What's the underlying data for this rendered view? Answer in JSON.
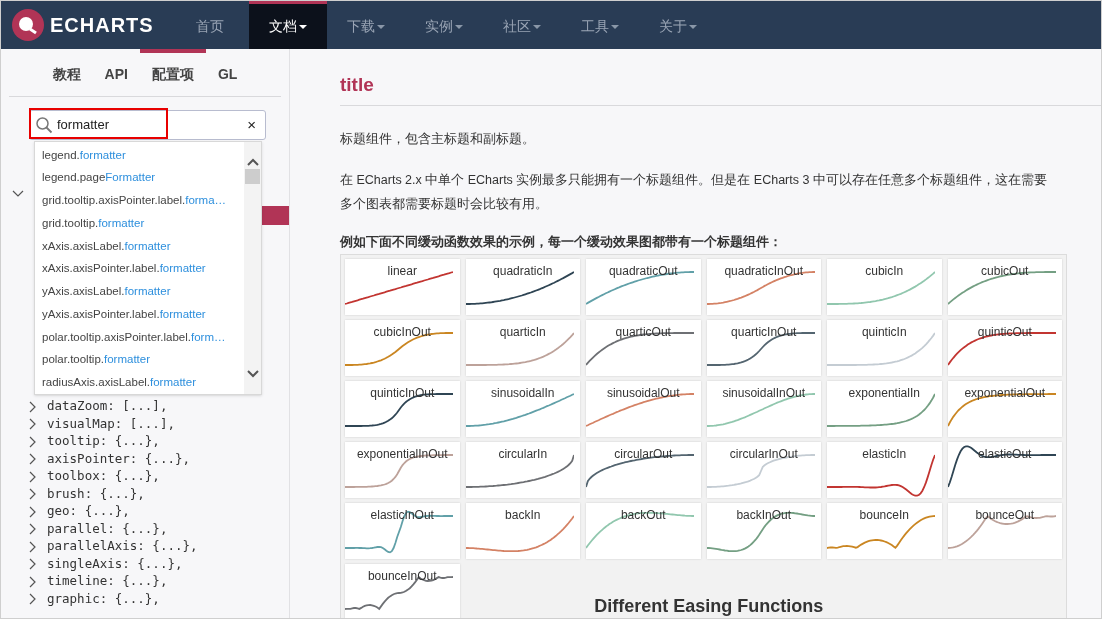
{
  "navbar": {
    "logo_text": "ECHARTS",
    "items": [
      {
        "label": "首页",
        "selected": false,
        "has_menu": false
      },
      {
        "label": "文档",
        "selected": true,
        "has_menu": true
      },
      {
        "label": "下载",
        "selected": false,
        "has_menu": true
      },
      {
        "label": "实例",
        "selected": false,
        "has_menu": true
      },
      {
        "label": "社区",
        "selected": false,
        "has_menu": true
      },
      {
        "label": "工具",
        "selected": false,
        "has_menu": true
      },
      {
        "label": "关于",
        "selected": false,
        "has_menu": true
      }
    ]
  },
  "sidebar": {
    "tabs": [
      {
        "label": "教程",
        "selected": false
      },
      {
        "label": "API",
        "selected": false
      },
      {
        "label": "配置项",
        "selected": true
      },
      {
        "label": "GL",
        "selected": false
      }
    ],
    "search": {
      "value": "formatter",
      "clear_label": "×"
    },
    "suggestions": [
      {
        "prefix": "legend.",
        "match": "formatter"
      },
      {
        "prefix": "legend.page",
        "match": "Formatter"
      },
      {
        "prefix": "grid.tooltip.axisPointer.label.",
        "match": "forma…"
      },
      {
        "prefix": "grid.tooltip.",
        "match": "formatter"
      },
      {
        "prefix": "xAxis.axisLabel.",
        "match": "formatter"
      },
      {
        "prefix": "xAxis.axisPointer.label.",
        "match": "formatter"
      },
      {
        "prefix": "yAxis.axisLabel.",
        "match": "formatter"
      },
      {
        "prefix": "yAxis.axisPointer.label.",
        "match": "formatter"
      },
      {
        "prefix": "polar.tooltip.axisPointer.label.",
        "match": "form…"
      },
      {
        "prefix": "polar.tooltip.",
        "match": "formatter"
      },
      {
        "prefix": "radiusAxis.axisLabel.",
        "match": "formatter"
      }
    ],
    "tree": {
      "expanded": true,
      "children": [
        {
          "label": "dataZoom: [...],",
          "expanded": false
        },
        {
          "label": "visualMap: [...],",
          "expanded": false
        },
        {
          "label": "tooltip: {...},",
          "expanded": false
        },
        {
          "label": "axisPointer: {...},",
          "expanded": false
        },
        {
          "label": "toolbox: {...},",
          "expanded": false
        },
        {
          "label": "brush: {...},",
          "expanded": false
        },
        {
          "label": "geo: {...},",
          "expanded": false
        },
        {
          "label": "parallel: {...},",
          "expanded": false
        },
        {
          "label": "parallelAxis: {...},",
          "expanded": false
        },
        {
          "label": "singleAxis: {...},",
          "expanded": false
        },
        {
          "label": "timeline: {...},",
          "expanded": false
        },
        {
          "label": "graphic: {...},",
          "expanded": false
        }
      ]
    }
  },
  "content": {
    "title": "title",
    "paragraphs": [
      {
        "lines": [
          "标题组件，包含主标题和副标题。"
        ]
      },
      {
        "lines": [
          "在 ECharts 2.x 中单个 ECharts 实例最多只能拥有一个标题组件。但是在 ECharts 3 中可以存在任意多个标题组件，这在需要",
          "多个图表都需要标题时会比较有用。"
        ]
      }
    ],
    "caption": "例如下面不同缓动函数效果的示例，每一个缓动效果图都带有一个标题组件：",
    "figure": {
      "title": "Different Easing Functions",
      "easings": [
        {
          "name": "linear",
          "color": "#c23531"
        },
        {
          "name": "quadraticIn",
          "color": "#2f4554"
        },
        {
          "name": "quadraticOut",
          "color": "#61a0a8"
        },
        {
          "name": "quadraticInOut",
          "color": "#d48265"
        },
        {
          "name": "cubicIn",
          "color": "#91c7ae"
        },
        {
          "name": "cubicOut",
          "color": "#749f83"
        },
        {
          "name": "cubicInOut",
          "color": "#ca8622"
        },
        {
          "name": "quarticIn",
          "color": "#bda29a"
        },
        {
          "name": "quarticOut",
          "color": "#6e7074"
        },
        {
          "name": "quarticInOut",
          "color": "#546570"
        },
        {
          "name": "quinticIn",
          "color": "#c4ccd3"
        },
        {
          "name": "quinticOut",
          "color": "#c23531"
        },
        {
          "name": "quinticInOut",
          "color": "#2f4554"
        },
        {
          "name": "sinusoidalIn",
          "color": "#61a0a8"
        },
        {
          "name": "sinusoidalOut",
          "color": "#d48265"
        },
        {
          "name": "sinusoidalInOut",
          "color": "#91c7ae"
        },
        {
          "name": "exponentialIn",
          "color": "#749f83"
        },
        {
          "name": "exponentialOut",
          "color": "#ca8622"
        },
        {
          "name": "exponentialInOut",
          "color": "#bda29a"
        },
        {
          "name": "circularIn",
          "color": "#6e7074"
        },
        {
          "name": "circularOut",
          "color": "#546570"
        },
        {
          "name": "circularInOut",
          "color": "#c4ccd3"
        },
        {
          "name": "elasticIn",
          "color": "#c23531"
        },
        {
          "name": "elasticOut",
          "color": "#2f4554"
        },
        {
          "name": "elasticInOut",
          "color": "#61a0a8"
        },
        {
          "name": "backIn",
          "color": "#d48265"
        },
        {
          "name": "backOut",
          "color": "#91c7ae"
        },
        {
          "name": "backInOut",
          "color": "#749f83"
        },
        {
          "name": "bounceIn",
          "color": "#ca8622"
        },
        {
          "name": "bounceOut",
          "color": "#bda29a"
        },
        {
          "name": "bounceInOut",
          "color": "#6e7074"
        }
      ]
    }
  }
}
